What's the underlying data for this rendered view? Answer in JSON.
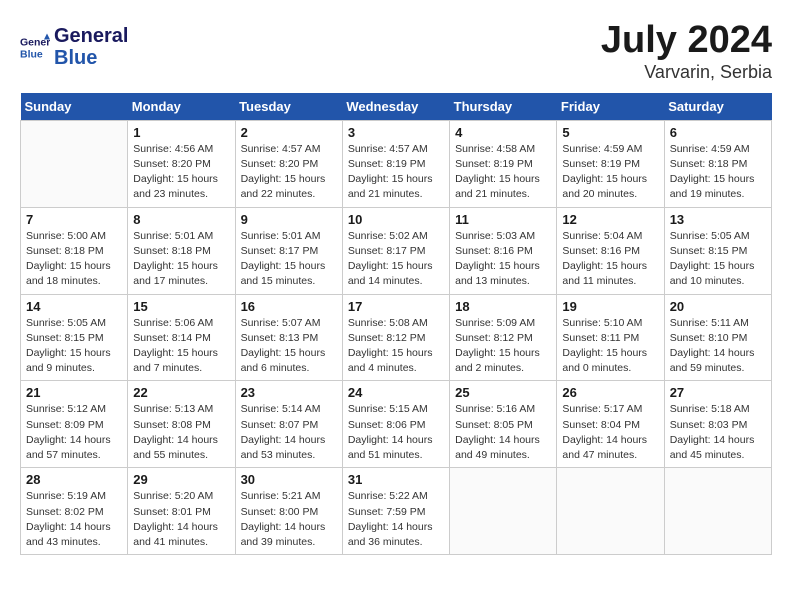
{
  "header": {
    "logo_line1": "General",
    "logo_line2": "Blue",
    "month_year": "July 2024",
    "location": "Varvarin, Serbia"
  },
  "weekdays": [
    "Sunday",
    "Monday",
    "Tuesday",
    "Wednesday",
    "Thursday",
    "Friday",
    "Saturday"
  ],
  "weeks": [
    [
      {
        "day": "",
        "sunrise": "",
        "sunset": "",
        "daylight": ""
      },
      {
        "day": "1",
        "sunrise": "Sunrise: 4:56 AM",
        "sunset": "Sunset: 8:20 PM",
        "daylight": "Daylight: 15 hours and 23 minutes."
      },
      {
        "day": "2",
        "sunrise": "Sunrise: 4:57 AM",
        "sunset": "Sunset: 8:20 PM",
        "daylight": "Daylight: 15 hours and 22 minutes."
      },
      {
        "day": "3",
        "sunrise": "Sunrise: 4:57 AM",
        "sunset": "Sunset: 8:19 PM",
        "daylight": "Daylight: 15 hours and 21 minutes."
      },
      {
        "day": "4",
        "sunrise": "Sunrise: 4:58 AM",
        "sunset": "Sunset: 8:19 PM",
        "daylight": "Daylight: 15 hours and 21 minutes."
      },
      {
        "day": "5",
        "sunrise": "Sunrise: 4:59 AM",
        "sunset": "Sunset: 8:19 PM",
        "daylight": "Daylight: 15 hours and 20 minutes."
      },
      {
        "day": "6",
        "sunrise": "Sunrise: 4:59 AM",
        "sunset": "Sunset: 8:18 PM",
        "daylight": "Daylight: 15 hours and 19 minutes."
      }
    ],
    [
      {
        "day": "7",
        "sunrise": "Sunrise: 5:00 AM",
        "sunset": "Sunset: 8:18 PM",
        "daylight": "Daylight: 15 hours and 18 minutes."
      },
      {
        "day": "8",
        "sunrise": "Sunrise: 5:01 AM",
        "sunset": "Sunset: 8:18 PM",
        "daylight": "Daylight: 15 hours and 17 minutes."
      },
      {
        "day": "9",
        "sunrise": "Sunrise: 5:01 AM",
        "sunset": "Sunset: 8:17 PM",
        "daylight": "Daylight: 15 hours and 15 minutes."
      },
      {
        "day": "10",
        "sunrise": "Sunrise: 5:02 AM",
        "sunset": "Sunset: 8:17 PM",
        "daylight": "Daylight: 15 hours and 14 minutes."
      },
      {
        "day": "11",
        "sunrise": "Sunrise: 5:03 AM",
        "sunset": "Sunset: 8:16 PM",
        "daylight": "Daylight: 15 hours and 13 minutes."
      },
      {
        "day": "12",
        "sunrise": "Sunrise: 5:04 AM",
        "sunset": "Sunset: 8:16 PM",
        "daylight": "Daylight: 15 hours and 11 minutes."
      },
      {
        "day": "13",
        "sunrise": "Sunrise: 5:05 AM",
        "sunset": "Sunset: 8:15 PM",
        "daylight": "Daylight: 15 hours and 10 minutes."
      }
    ],
    [
      {
        "day": "14",
        "sunrise": "Sunrise: 5:05 AM",
        "sunset": "Sunset: 8:15 PM",
        "daylight": "Daylight: 15 hours and 9 minutes."
      },
      {
        "day": "15",
        "sunrise": "Sunrise: 5:06 AM",
        "sunset": "Sunset: 8:14 PM",
        "daylight": "Daylight: 15 hours and 7 minutes."
      },
      {
        "day": "16",
        "sunrise": "Sunrise: 5:07 AM",
        "sunset": "Sunset: 8:13 PM",
        "daylight": "Daylight: 15 hours and 6 minutes."
      },
      {
        "day": "17",
        "sunrise": "Sunrise: 5:08 AM",
        "sunset": "Sunset: 8:12 PM",
        "daylight": "Daylight: 15 hours and 4 minutes."
      },
      {
        "day": "18",
        "sunrise": "Sunrise: 5:09 AM",
        "sunset": "Sunset: 8:12 PM",
        "daylight": "Daylight: 15 hours and 2 minutes."
      },
      {
        "day": "19",
        "sunrise": "Sunrise: 5:10 AM",
        "sunset": "Sunset: 8:11 PM",
        "daylight": "Daylight: 15 hours and 0 minutes."
      },
      {
        "day": "20",
        "sunrise": "Sunrise: 5:11 AM",
        "sunset": "Sunset: 8:10 PM",
        "daylight": "Daylight: 14 hours and 59 minutes."
      }
    ],
    [
      {
        "day": "21",
        "sunrise": "Sunrise: 5:12 AM",
        "sunset": "Sunset: 8:09 PM",
        "daylight": "Daylight: 14 hours and 57 minutes."
      },
      {
        "day": "22",
        "sunrise": "Sunrise: 5:13 AM",
        "sunset": "Sunset: 8:08 PM",
        "daylight": "Daylight: 14 hours and 55 minutes."
      },
      {
        "day": "23",
        "sunrise": "Sunrise: 5:14 AM",
        "sunset": "Sunset: 8:07 PM",
        "daylight": "Daylight: 14 hours and 53 minutes."
      },
      {
        "day": "24",
        "sunrise": "Sunrise: 5:15 AM",
        "sunset": "Sunset: 8:06 PM",
        "daylight": "Daylight: 14 hours and 51 minutes."
      },
      {
        "day": "25",
        "sunrise": "Sunrise: 5:16 AM",
        "sunset": "Sunset: 8:05 PM",
        "daylight": "Daylight: 14 hours and 49 minutes."
      },
      {
        "day": "26",
        "sunrise": "Sunrise: 5:17 AM",
        "sunset": "Sunset: 8:04 PM",
        "daylight": "Daylight: 14 hours and 47 minutes."
      },
      {
        "day": "27",
        "sunrise": "Sunrise: 5:18 AM",
        "sunset": "Sunset: 8:03 PM",
        "daylight": "Daylight: 14 hours and 45 minutes."
      }
    ],
    [
      {
        "day": "28",
        "sunrise": "Sunrise: 5:19 AM",
        "sunset": "Sunset: 8:02 PM",
        "daylight": "Daylight: 14 hours and 43 minutes."
      },
      {
        "day": "29",
        "sunrise": "Sunrise: 5:20 AM",
        "sunset": "Sunset: 8:01 PM",
        "daylight": "Daylight: 14 hours and 41 minutes."
      },
      {
        "day": "30",
        "sunrise": "Sunrise: 5:21 AM",
        "sunset": "Sunset: 8:00 PM",
        "daylight": "Daylight: 14 hours and 39 minutes."
      },
      {
        "day": "31",
        "sunrise": "Sunrise: 5:22 AM",
        "sunset": "Sunset: 7:59 PM",
        "daylight": "Daylight: 14 hours and 36 minutes."
      },
      {
        "day": "",
        "sunrise": "",
        "sunset": "",
        "daylight": ""
      },
      {
        "day": "",
        "sunrise": "",
        "sunset": "",
        "daylight": ""
      },
      {
        "day": "",
        "sunrise": "",
        "sunset": "",
        "daylight": ""
      }
    ]
  ]
}
